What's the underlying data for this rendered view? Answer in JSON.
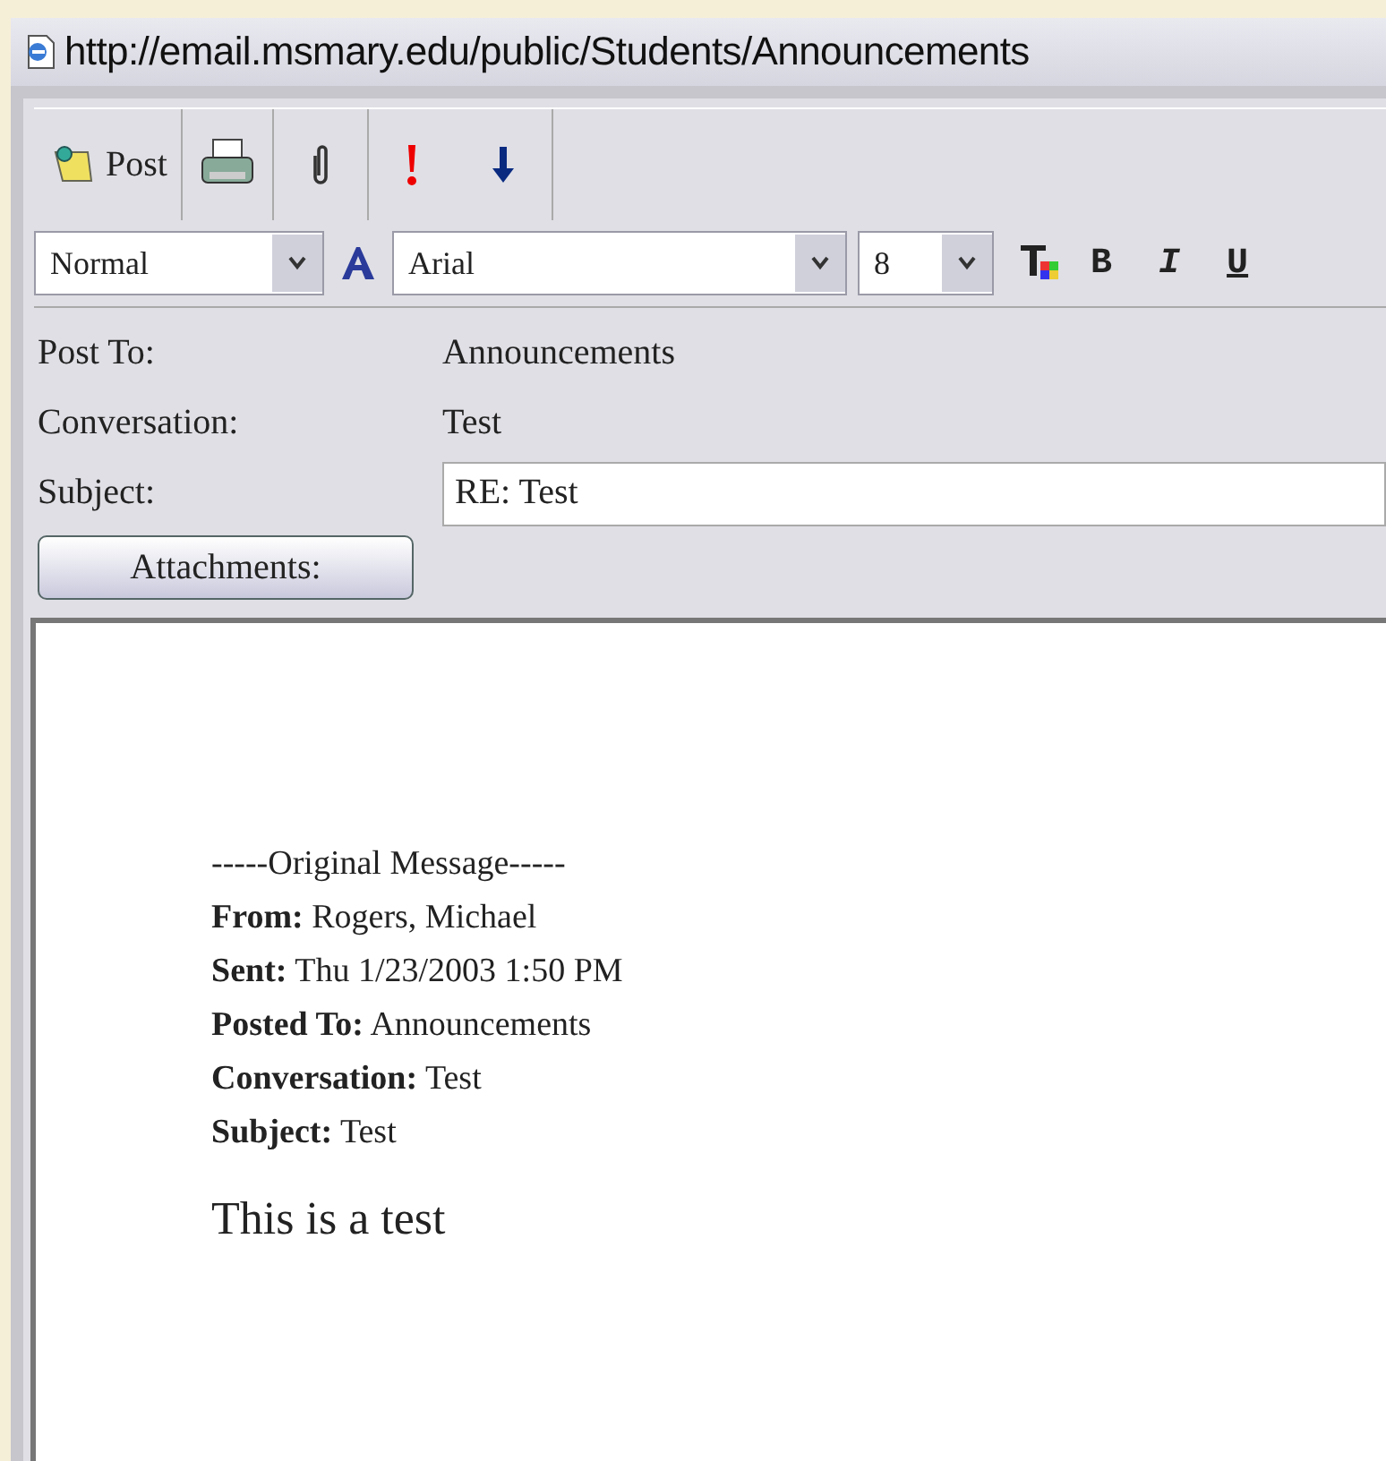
{
  "window": {
    "title": "http://email.msmary.edu/public/Students/Announcements"
  },
  "toolbar": {
    "buttons": [
      {
        "kind": "post",
        "label": "Post"
      },
      {
        "kind": "print"
      },
      {
        "kind": "attach"
      },
      {
        "kind": "high"
      },
      {
        "kind": "low"
      }
    ]
  },
  "format_bar": {
    "style": "Normal",
    "font": "Arial",
    "size": "8",
    "buttons": [
      {
        "kind": "color"
      },
      {
        "kind": "bold",
        "label": "B"
      },
      {
        "kind": "italic",
        "label": "I"
      },
      {
        "kind": "underline",
        "label": "U"
      }
    ]
  },
  "fields": [
    {
      "label": "Post To:",
      "value": "Announcements",
      "kind": "text"
    },
    {
      "label": "Conversation:",
      "value": "Test",
      "kind": "text"
    },
    {
      "label": "Subject:",
      "value": "RE: Test",
      "kind": "input"
    }
  ],
  "attachments_button": "Attachments:",
  "message": {
    "separator": "-----Original Message-----",
    "header": [
      {
        "label": "From:",
        "value": "Rogers, Michael"
      },
      {
        "label": "Sent:",
        "value": "Thu 1/23/2003 1:50 PM"
      },
      {
        "label": "Posted To:",
        "value": "Announcements"
      },
      {
        "label": "Conversation:",
        "value": "Test"
      },
      {
        "label": "Subject:",
        "value": "Test"
      }
    ],
    "body": "This is a test"
  }
}
